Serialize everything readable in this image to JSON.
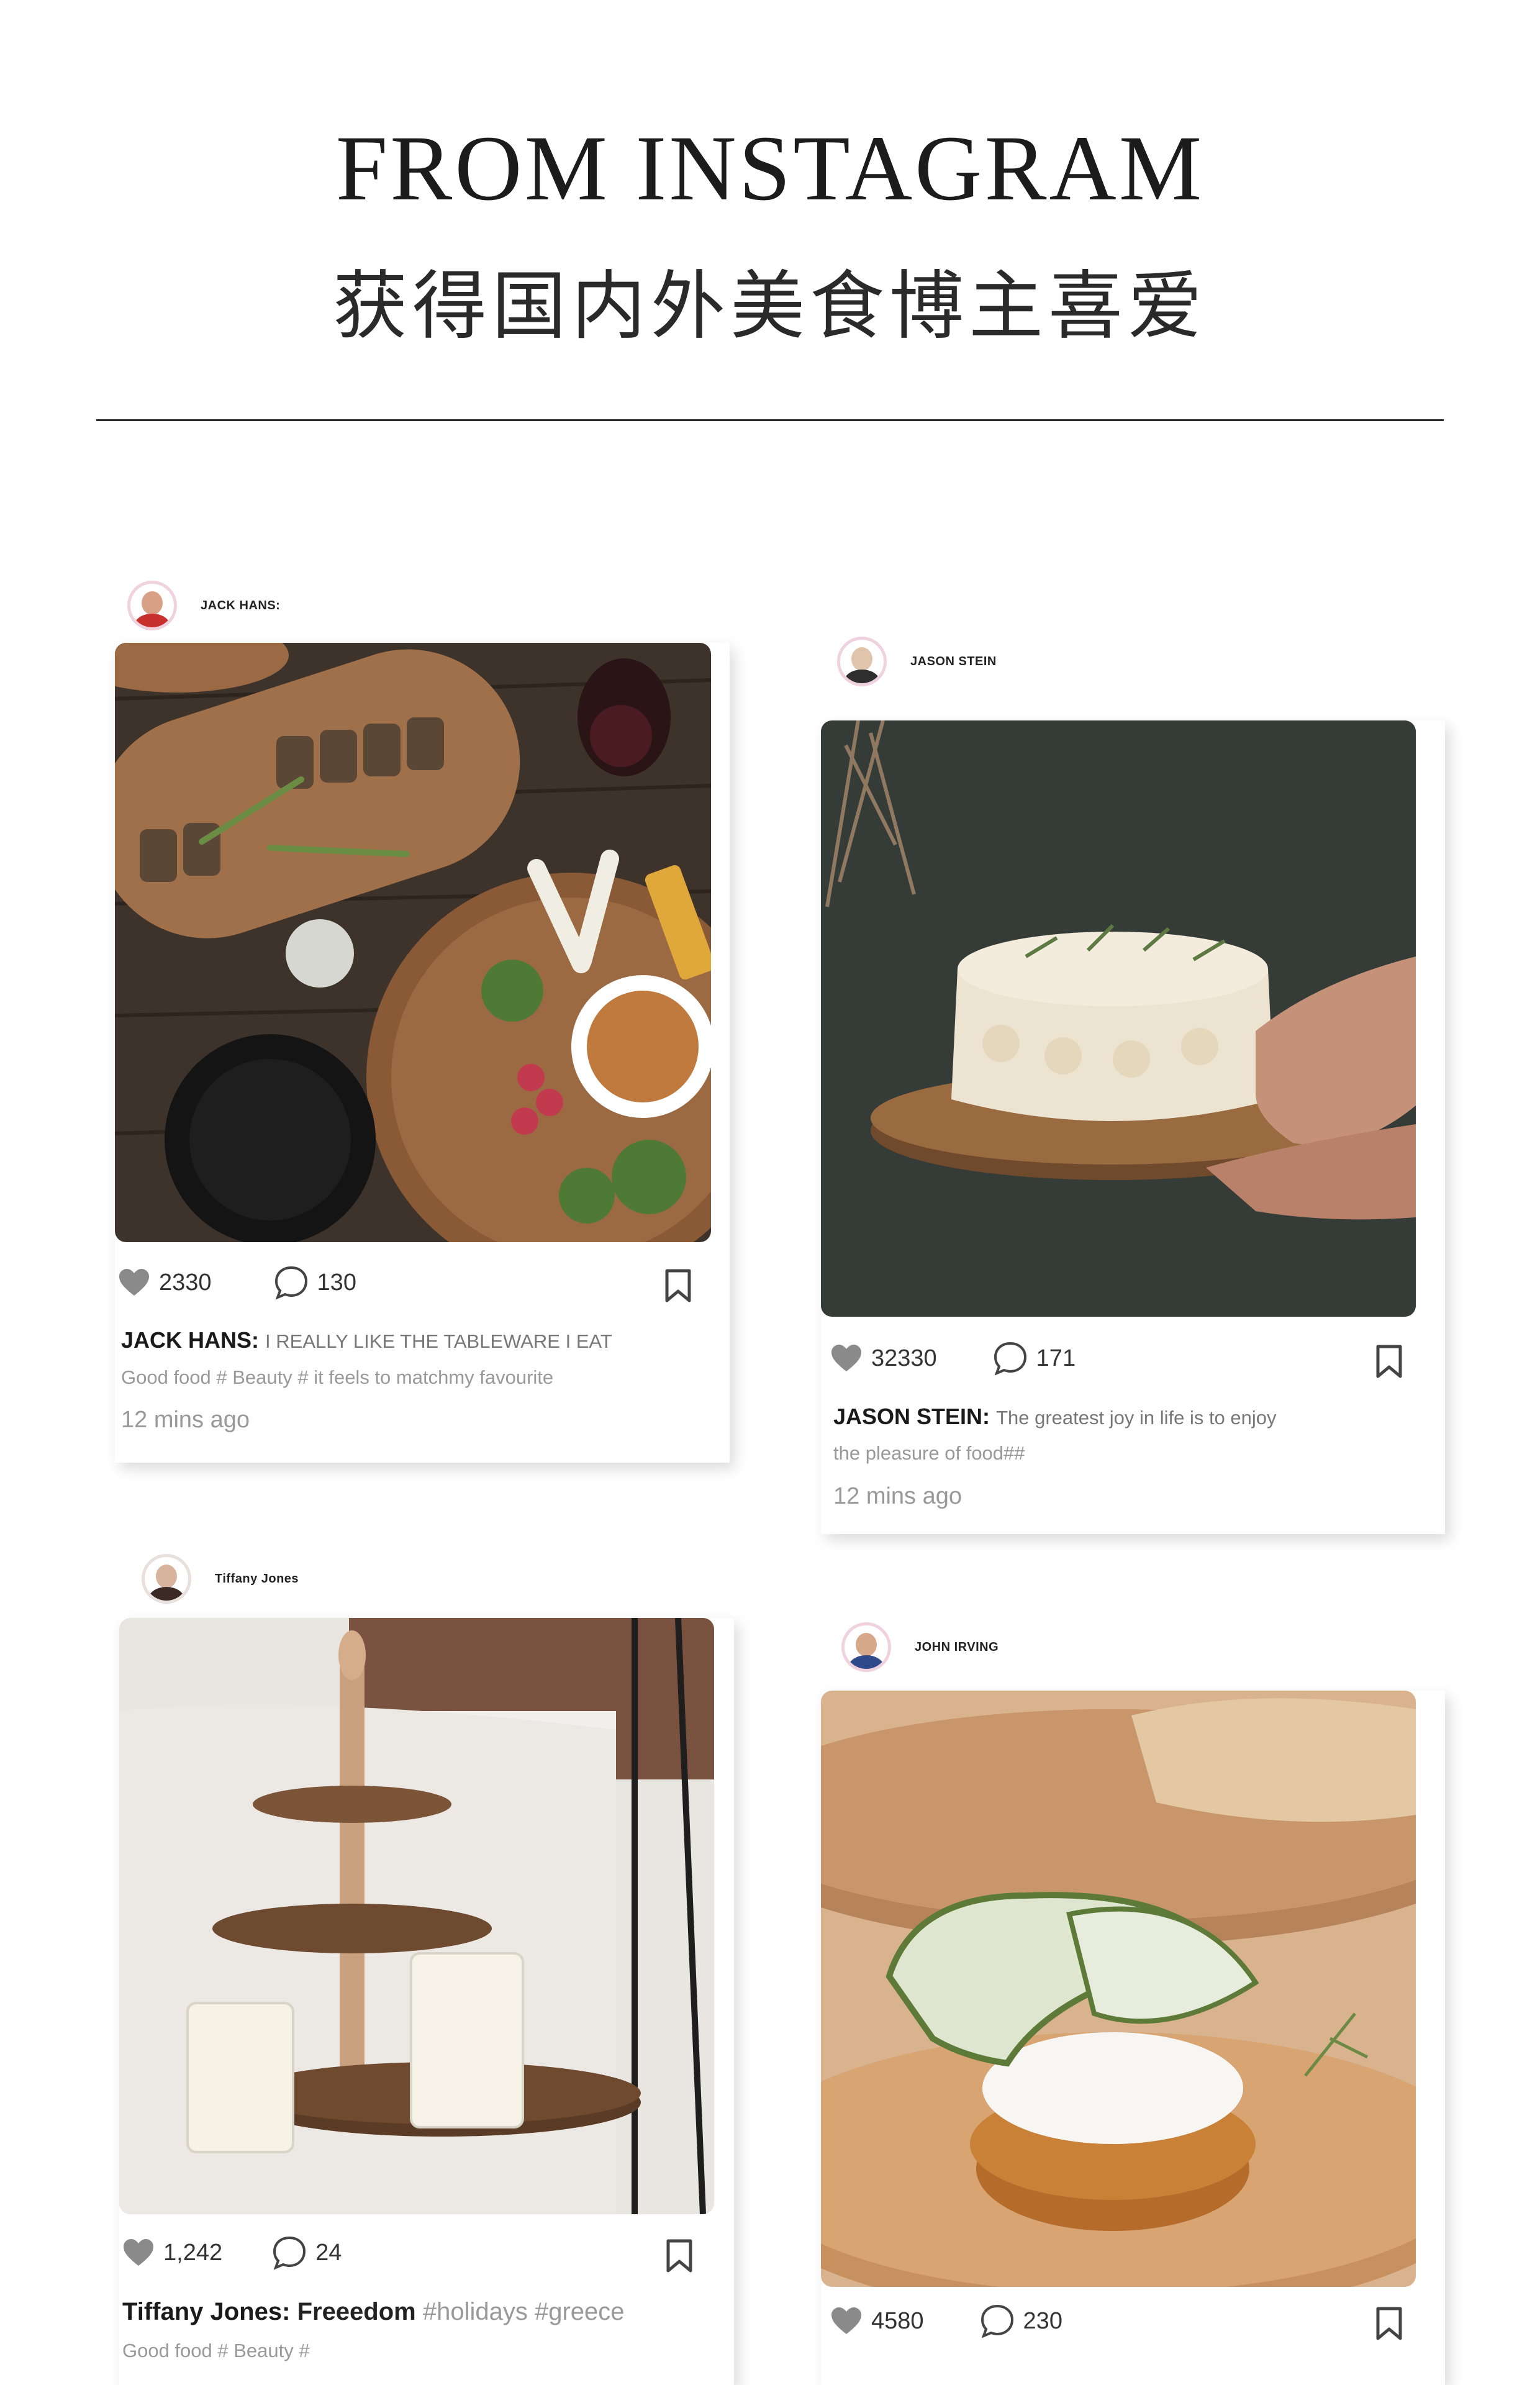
{
  "header": {
    "title": "FROM INSTAGRAM",
    "subtitle": "获得国内外美食博主喜爱"
  },
  "posts": [
    {
      "username": "JACK HANS:",
      "likes": "2330",
      "comments": "130",
      "caption_user": "JACK HANS:",
      "caption_text": "I REALLY LIKE THE TABLEWARE I EAT",
      "tagline": "Good food # Beauty #   it feels to matchmy favourite",
      "time": "12 mins ago"
    },
    {
      "username": "JASON STEIN",
      "likes": "32330",
      "comments": "171",
      "caption_user": "JASON STEIN:",
      "caption_text": "The greatest joy in life is to enjoy",
      "tagline": "the pleasure of food##",
      "time": "12 mins ago"
    },
    {
      "username": "Tiffany Jones",
      "likes": "1,242",
      "comments": "24",
      "caption_user": "Tiffany Jones:",
      "caption_text": "Freeedom",
      "caption_tags": "#holidays #greece",
      "tagline": "Good food # Beauty #"
    },
    {
      "username": "JOHN IRVING",
      "likes": "4580",
      "comments": "230"
    }
  ],
  "colors": {
    "avatar_ring": "#f0d2de",
    "icon_gray": "#8a8a8a",
    "text_gray": "#999999"
  },
  "icons": [
    "heart-icon",
    "comment-icon",
    "bookmark-icon"
  ]
}
